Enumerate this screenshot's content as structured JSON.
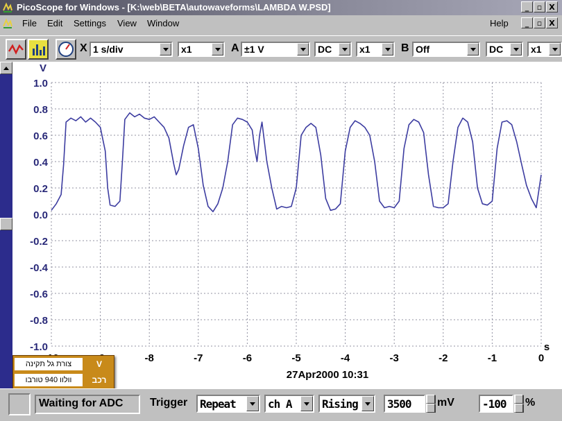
{
  "window": {
    "title": "PicoScope for Windows - [K:\\web\\BETA\\autowaveforms\\LAMBDA W.PSD]",
    "buttons": [
      "_",
      "▫",
      "X"
    ]
  },
  "menu": {
    "items": [
      "File",
      "Edit",
      "Settings",
      "View",
      "Window"
    ],
    "help": "Help",
    "child_buttons": [
      "_",
      "▫",
      "X"
    ]
  },
  "toolbar": {
    "x_label": "X",
    "timebase": "1 s/div",
    "x_mult": "x1",
    "a_label": "A",
    "a_range": "±1 V",
    "a_coupling": "DC",
    "a_mult": "x1",
    "b_label": "B",
    "b_range": "Off",
    "b_coupling": "DC",
    "b_mult": "x1",
    "icons": [
      "scope-icon",
      "spectrum-icon",
      "meter-icon"
    ]
  },
  "chart_data": {
    "type": "line",
    "y_unit": "V",
    "x_unit": "s",
    "ylim": [
      -1.0,
      1.0
    ],
    "xlim": [
      -10,
      0
    ],
    "y_ticks": [
      "1.0",
      "0.8",
      "0.6",
      "0.4",
      "0.2",
      "0.0",
      "-0.2",
      "-0.4",
      "-0.6",
      "-0.8",
      "-1.0"
    ],
    "x_ticks": [
      "-10",
      "-9",
      "-8",
      "-7",
      "-6",
      "-5",
      "-4",
      "-3",
      "-2",
      "-1",
      "0"
    ],
    "grid": true,
    "timestamp": "27Apr2000  10:31",
    "series": [
      {
        "color": "#3c3ca0",
        "x": [
          -10.0,
          -9.9,
          -9.8,
          -9.75,
          -9.7,
          -9.6,
          -9.5,
          -9.4,
          -9.3,
          -9.2,
          -9.1,
          -9.0,
          -8.9,
          -8.85,
          -8.8,
          -8.7,
          -8.6,
          -8.55,
          -8.5,
          -8.4,
          -8.3,
          -8.2,
          -8.1,
          -8.0,
          -7.9,
          -7.8,
          -7.7,
          -7.6,
          -7.5,
          -7.45,
          -7.4,
          -7.3,
          -7.2,
          -7.1,
          -7.0,
          -6.9,
          -6.8,
          -6.7,
          -6.6,
          -6.5,
          -6.4,
          -6.3,
          -6.2,
          -6.1,
          -6.0,
          -5.9,
          -5.85,
          -5.8,
          -5.75,
          -5.7,
          -5.6,
          -5.5,
          -5.4,
          -5.3,
          -5.2,
          -5.1,
          -5.0,
          -4.9,
          -4.8,
          -4.7,
          -4.6,
          -4.5,
          -4.4,
          -4.3,
          -4.2,
          -4.1,
          -4.0,
          -3.9,
          -3.8,
          -3.7,
          -3.6,
          -3.5,
          -3.4,
          -3.3,
          -3.2,
          -3.1,
          -3.0,
          -2.9,
          -2.8,
          -2.7,
          -2.6,
          -2.5,
          -2.4,
          -2.3,
          -2.2,
          -2.1,
          -2.0,
          -1.9,
          -1.8,
          -1.7,
          -1.6,
          -1.5,
          -1.4,
          -1.3,
          -1.2,
          -1.1,
          -1.0,
          -0.9,
          -0.8,
          -0.7,
          -0.6,
          -0.5,
          -0.4,
          -0.3,
          -0.2,
          -0.1,
          0.0
        ],
        "y": [
          0.03,
          0.08,
          0.15,
          0.38,
          0.7,
          0.73,
          0.71,
          0.74,
          0.7,
          0.73,
          0.7,
          0.66,
          0.48,
          0.2,
          0.07,
          0.06,
          0.1,
          0.4,
          0.72,
          0.77,
          0.74,
          0.76,
          0.73,
          0.72,
          0.74,
          0.7,
          0.66,
          0.58,
          0.38,
          0.3,
          0.34,
          0.52,
          0.66,
          0.68,
          0.5,
          0.22,
          0.06,
          0.02,
          0.08,
          0.2,
          0.4,
          0.68,
          0.73,
          0.72,
          0.7,
          0.64,
          0.5,
          0.4,
          0.6,
          0.7,
          0.4,
          0.2,
          0.04,
          0.06,
          0.05,
          0.06,
          0.2,
          0.6,
          0.66,
          0.69,
          0.66,
          0.45,
          0.12,
          0.03,
          0.04,
          0.08,
          0.48,
          0.66,
          0.71,
          0.69,
          0.66,
          0.6,
          0.4,
          0.1,
          0.05,
          0.06,
          0.05,
          0.1,
          0.5,
          0.68,
          0.72,
          0.7,
          0.62,
          0.3,
          0.06,
          0.05,
          0.05,
          0.08,
          0.4,
          0.66,
          0.73,
          0.7,
          0.55,
          0.2,
          0.08,
          0.07,
          0.1,
          0.5,
          0.7,
          0.71,
          0.68,
          0.55,
          0.38,
          0.22,
          0.12,
          0.05,
          0.3
        ]
      }
    ]
  },
  "legend": {
    "rows": [
      {
        "key": "V",
        "text": "צורת גל תקינה"
      },
      {
        "key": "רכב",
        "text": "וולוו 940 טורבו"
      }
    ]
  },
  "status": {
    "state": "Waiting for ADC",
    "trigger_label": "Trigger",
    "trigger_mode": "Repeat",
    "trigger_channel": "ch A",
    "trigger_edge": "Rising",
    "trigger_level": "3500",
    "level_unit": "mV",
    "pretrigger": "-100",
    "pretrigger_unit": "%"
  }
}
